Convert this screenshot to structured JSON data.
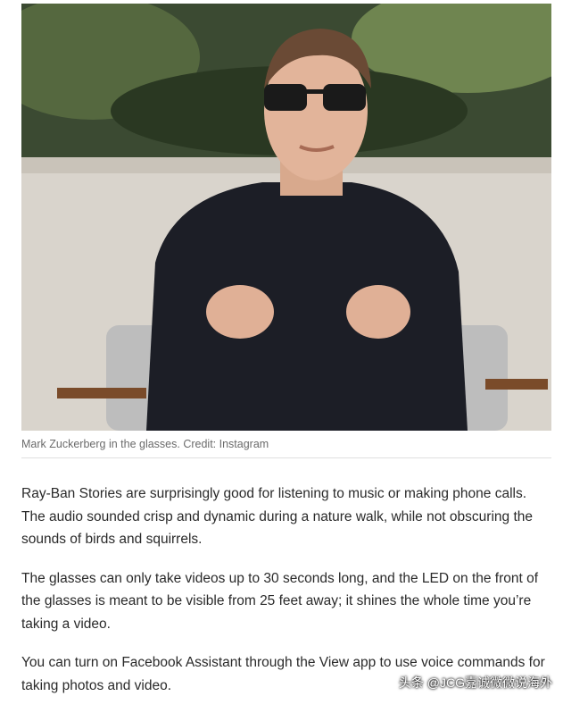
{
  "article": {
    "image_caption": "Mark Zuckerberg in the glasses. Credit: Instagram",
    "paragraphs": [
      "Ray-Ban Stories are surprisingly good for listening to music or making phone calls. The audio sounded crisp and dynamic during a nature walk, while not obscuring the sounds of birds and squirrels.",
      "The glasses can only take videos up to 30 seconds long, and the LED on the front of the glasses is meant to be visible from 25 feet away; it shines the whole time you’re taking a video.",
      "You can turn on Facebook Assistant through the View app to use voice commands for taking photos and video."
    ]
  },
  "watermark": "头条 @JCG嘉诚微微说海外",
  "colors": {
    "caption_text": "#6b6b6b",
    "body_text": "#2a2a2a",
    "divider": "#e0e0e0"
  }
}
